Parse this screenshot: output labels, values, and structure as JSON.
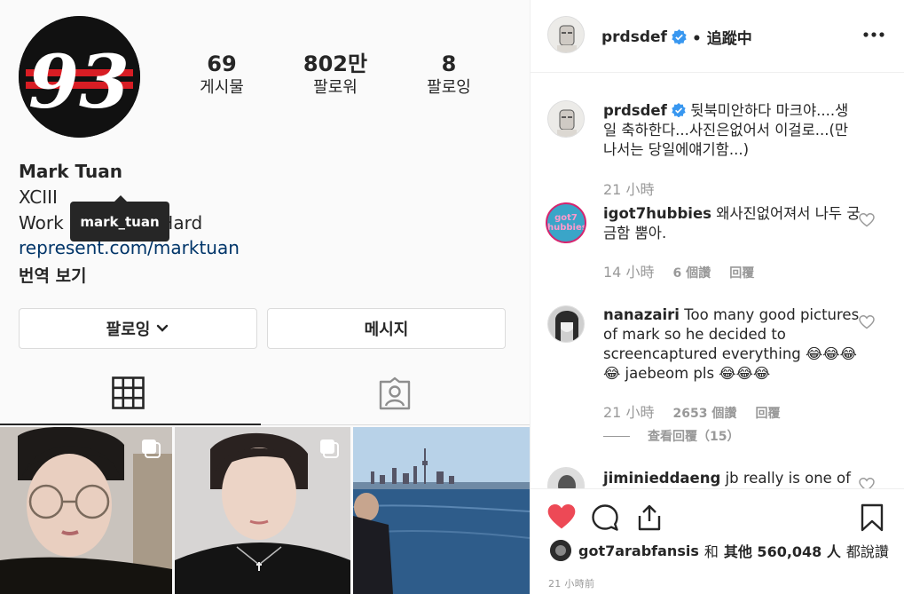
{
  "profile": {
    "avatar_text": "93",
    "stats": [
      {
        "value": "69",
        "label": "게시물"
      },
      {
        "value": "802만",
        "label": "팔로워"
      },
      {
        "value": "8",
        "label": "팔로잉"
      }
    ],
    "name": "Mark Tuan",
    "bio_line1": "XCIII",
    "bio_line2": "Work Hard Play Hard",
    "link": "represent.com/marktuan",
    "translate": "번역 보기",
    "tooltip": "mark_tuan",
    "follow_button": "팔로잉",
    "message_button": "메시지",
    "icons": {
      "grid_tab": "grid-icon",
      "tagged_tab": "tagged-icon",
      "multi": "multiple-posts-icon",
      "follow_chevron": "chevron-down-icon"
    }
  },
  "post": {
    "author": "prdsdef",
    "follow_status": "• 追蹤中",
    "more": "...",
    "caption": "뒷북미안하다 마크야....생일 축하한다...사진은없어서 이걸로...(만나서는 당일에얘기함...)",
    "caption_time": "21 小時",
    "comments": [
      {
        "user": "igot7hubbies",
        "text": "왜사진없어져서 나두 궁금함 뿜아.",
        "time": "14 小時",
        "likes": "6 個讚",
        "reply": "回覆",
        "avatar_text": "got7 hubbies"
      },
      {
        "user": "nanazairi",
        "text": "Too many good pictures of mark so he decided to screencaptured everything 😂😂😂😂 jaebeom pls 😂😂😂",
        "time": "21 小時",
        "likes": "2653 個讚",
        "reply": "回覆",
        "view_replies": "查看回覆（15）"
      },
      {
        "user": "jiminieddaeng",
        "text": "jb really is one of a"
      }
    ],
    "liked_by_user": "got7arabfansis",
    "likes_text_and": "和",
    "likes_text_others": "其他 560,048 人",
    "likes_text_suffix": "都說讚",
    "post_time": "21 小時前",
    "icons": {
      "like": "heart-icon",
      "comment": "comment-icon",
      "share": "share-icon",
      "save": "bookmark-icon",
      "verified": "verified-badge-icon",
      "comment_like": "heart-outline-icon"
    }
  },
  "colors": {
    "link": "#003569",
    "heart": "#ed4956",
    "verified": "#3897f0",
    "muted": "#999999",
    "tooltip_bg": "#262626"
  }
}
